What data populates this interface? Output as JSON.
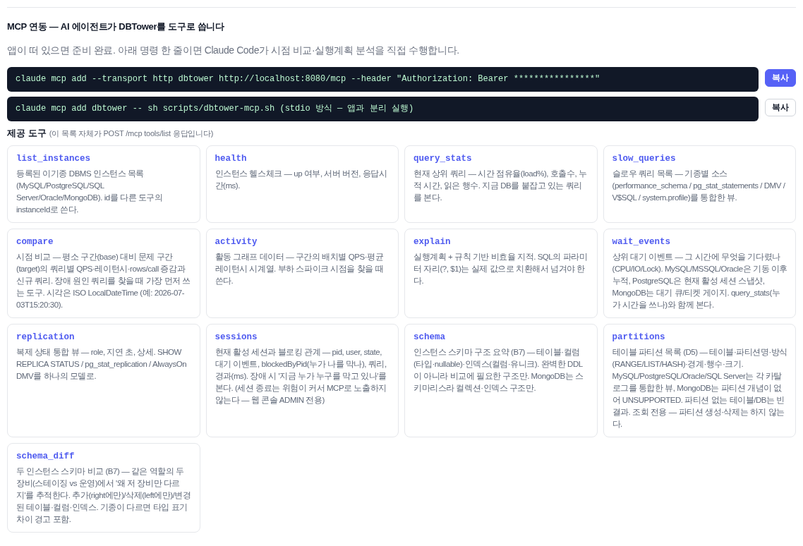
{
  "section": {
    "title": "MCP 연동 — AI 에이전트가 DBTower를 도구로 씁니다",
    "subtitle": "앱이 떠 있으면 준비 완료. 아래 명령 한 줄이면 Claude Code가 시점 비교·실행계획 분석을 직접 수행합니다."
  },
  "commands": [
    {
      "text": "claude mcp add --transport http dbtower http://localhost:8080/mcp --header \"Authorization: Bearer ****************\"",
      "button": {
        "label": "복사",
        "active": true
      }
    },
    {
      "text": "claude mcp add dbtower -- sh scripts/dbtower-mcp.sh (stdio 방식 — 앱과 분리 실행)",
      "button": {
        "label": "복사",
        "active": false
      }
    }
  ],
  "tools_header": {
    "title": "제공 도구",
    "note": "(이 목록 자체가 POST /mcp tools/list 응답입니다)"
  },
  "tools": [
    {
      "name": "list_instances",
      "description": "등록된 이기종 DBMS 인스턴스 목록 (MySQL/PostgreSQL/SQL Server/Oracle/MongoDB). id를 다른 도구의 instanceId로 쓴다."
    },
    {
      "name": "health",
      "description": "인스턴스 헬스체크 — up 여부, 서버 버전, 응답시간(ms)."
    },
    {
      "name": "query_stats",
      "description": "현재 상위 쿼리 — 시간 점유율(load%), 호출수, 누적 시간, 읽은 행수. 지금 DB를 붙잡고 있는 쿼리를 본다."
    },
    {
      "name": "slow_queries",
      "description": "슬로우 쿼리 목록 — 기종별 소스(performance_schema / pg_stat_statements / DMV / V$SQL / system.profile)를 통합한 뷰."
    },
    {
      "name": "compare",
      "description": "시점 비교 — 평소 구간(base) 대비 문제 구간(target)의 쿼리별 QPS·레이턴시·rows/call 증감과 신규 쿼리. 장애 원인 쿼리를 찾을 때 가장 먼저 쓰는 도구. 시각은 ISO LocalDateTime (예: 2026-07-03T15:20:30)."
    },
    {
      "name": "activity",
      "description": "활동 그래프 데이터 — 구간의 배치별 QPS·평균 레이턴시 시계열. 부하 스파이크 시점을 찾을 때 쓴다."
    },
    {
      "name": "explain",
      "description": "실행계획 + 규칙 기반 비효율 지적. SQL의 파라미터 자리(?, $1)는 실제 값으로 치환해서 넘겨야 한다."
    },
    {
      "name": "wait_events",
      "description": "상위 대기 이벤트 — 그 시간에 무엇을 기다렸나(CPU/IO/Lock). MySQL/MSSQL/Oracle은 기동 이후 누적, PostgreSQL은 현재 활성 세션 스냅샷, MongoDB는 대기 큐/티켓 게이지. query_stats(누가 시간을 쓰나)와 함께 본다."
    },
    {
      "name": "replication",
      "description": "복제 상태 통합 뷰 — role, 지연 초, 상세. SHOW REPLICA STATUS / pg_stat_replication / AlwaysOn DMV를 하나의 모델로."
    },
    {
      "name": "sessions",
      "description": "현재 활성 세션과 블로킹 관계 — pid, user, state, 대기 이벤트, blockedByPid(누가 나를 막나), 쿼리, 경과(ms). 장애 시 '지금 누가 누구를 막고 있나'를 본다. (세션 종료는 위험이 커서 MCP로 노출하지 않는다 — 웹 콘솔 ADMIN 전용)"
    },
    {
      "name": "schema",
      "description": "인스턴스 스키마 구조 요약 (B7) — 테이블·컬럼(타입·nullable)·인덱스(컬럼·유니크). 완벽한 DDL이 아니라 비교에 필요한 구조만. MongoDB는 스키마리스라 컬렉션·인덱스 구조만."
    },
    {
      "name": "partitions",
      "description": "테이블 파티션 목록 (D5) — 테이블·파티션명·방식(RANGE/LIST/HASH)·경계·행수·크기. MySQL/PostgreSQL/Oracle/SQL Server는 각 카탈로그를 통합한 뷰, MongoDB는 파티션 개념이 없어 UNSUPPORTED. 파티션 없는 테이블/DB는 빈 결과. 조회 전용 — 파티션 생성·삭제는 하지 않는다."
    },
    {
      "name": "schema_diff",
      "description": "두 인스턴스 스키마 비교 (B7) — 같은 역할의 두 장비(스테이징 vs 운영)에서 '왜 저 장비만 다르지'를 추적한다. 추가(right에만)/삭제(left에만)/변경된 테이블·컬럼·인덱스. 기종이 다르면 타입 표기 차이 경고 포함."
    }
  ]
}
